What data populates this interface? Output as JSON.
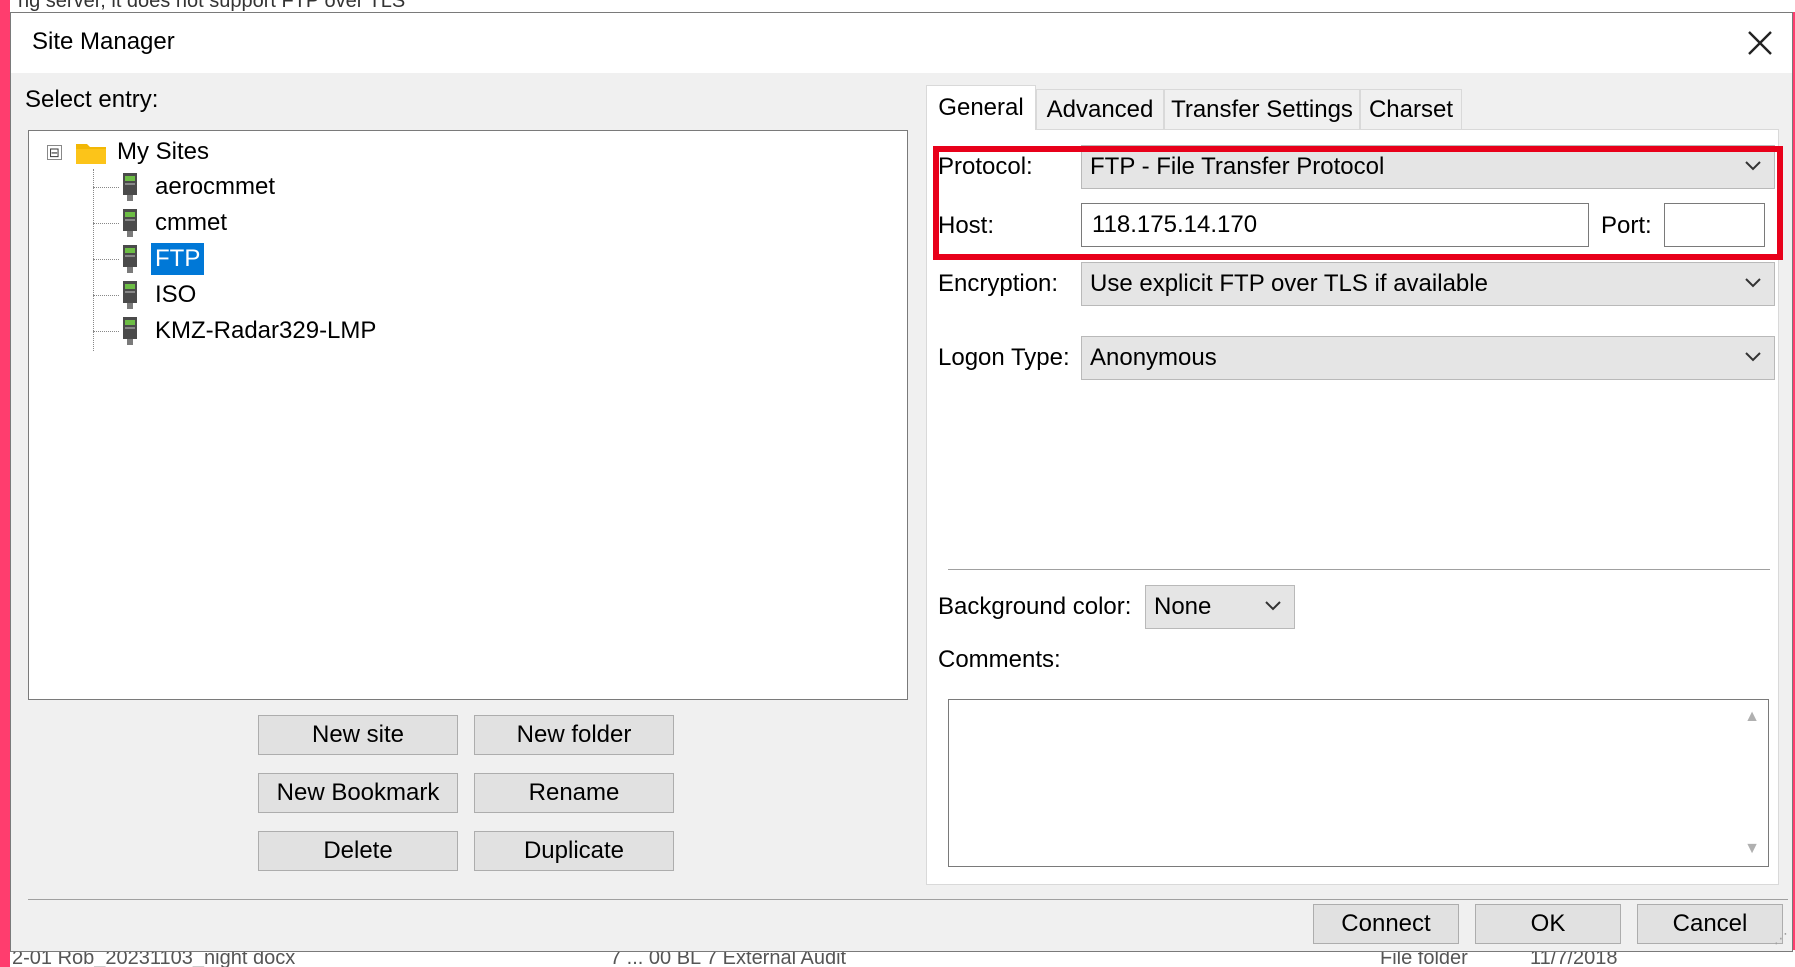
{
  "background": {
    "top_text": "ng server, it does not support FTP over TLS",
    "bottom_left": "2-01 Rob_20231103_night docx",
    "bottom_mid": "7 ... 00 BL 7 External Audit",
    "bottom_type": "File folder",
    "bottom_date": "11/7/2018"
  },
  "window": {
    "title": "Site Manager",
    "close_icon": "close-icon"
  },
  "left": {
    "select_entry_label": "Select entry:",
    "tree": {
      "root": {
        "label": "My Sites",
        "expander": "⊟"
      },
      "items": [
        {
          "label": "aerocmmet",
          "selected": false
        },
        {
          "label": "cmmet",
          "selected": false
        },
        {
          "label": "FTP",
          "selected": true
        },
        {
          "label": "ISO",
          "selected": false
        },
        {
          "label": "KMZ-Radar329-LMP",
          "selected": false
        }
      ]
    },
    "buttons": {
      "new_site": "New site",
      "new_folder": "New folder",
      "new_bookmark": "New Bookmark",
      "rename": "Rename",
      "delete": "Delete",
      "duplicate": "Duplicate"
    }
  },
  "tabs": [
    {
      "label": "General",
      "active": true
    },
    {
      "label": "Advanced",
      "active": false
    },
    {
      "label": "Transfer Settings",
      "active": false
    },
    {
      "label": "Charset",
      "active": false
    }
  ],
  "general": {
    "protocol_label": "Protocol:",
    "protocol_value": "FTP - File Transfer Protocol",
    "host_label": "Host:",
    "host_value": "118.175.14.170",
    "port_label": "Port:",
    "port_value": "",
    "encryption_label": "Encryption:",
    "encryption_value": "Use explicit FTP over TLS if available",
    "logon_label": "Logon Type:",
    "logon_value": "Anonymous",
    "bgcolor_label": "Background color:",
    "bgcolor_value": "None",
    "comments_label": "Comments:",
    "comments_value": ""
  },
  "footer": {
    "connect": "Connect",
    "ok": "OK",
    "cancel": "Cancel"
  },
  "colors": {
    "accent_border": "#ff3d6e",
    "highlight_box": "#e8001a",
    "selection": "#0078d7"
  }
}
